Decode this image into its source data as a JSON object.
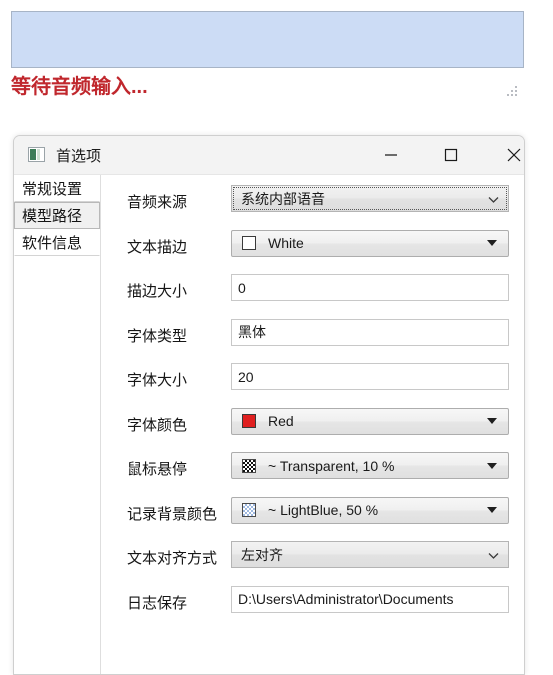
{
  "status_panel": {
    "name": "audio-waveform-panel",
    "background_color": "#ccdcf5",
    "border_color": "#a7b4c6"
  },
  "status": {
    "text": "等待音频输入...",
    "color": "#c0272d"
  },
  "dialog": {
    "title": "首选项",
    "icon": "app-icon",
    "window_controls": {
      "minimize": "minimize-icon",
      "maximize": "maximize-icon",
      "close": "close-icon"
    }
  },
  "sidebar": {
    "items": [
      {
        "label": "常规设置",
        "selected": false
      },
      {
        "label": "模型路径",
        "selected": true
      },
      {
        "label": "软件信息",
        "selected": false
      }
    ]
  },
  "form": {
    "rows": [
      {
        "label": "音频来源",
        "control": "combo-native",
        "value": "系统内部语音",
        "focused": true,
        "name": "audio-source-combo"
      },
      {
        "label": "文本描边",
        "control": "combo-color",
        "value": "White",
        "swatch": "solid",
        "swatch_color": "#ffffff",
        "name": "text-outline-color-combo"
      },
      {
        "label": "描边大小",
        "control": "textbox",
        "value": "0",
        "name": "outline-size-input"
      },
      {
        "label": "字体类型",
        "control": "textbox",
        "value": "黑体",
        "name": "font-family-input"
      },
      {
        "label": "字体大小",
        "control": "textbox",
        "value": "20",
        "name": "font-size-input"
      },
      {
        "label": "字体颜色",
        "control": "combo-color",
        "value": "Red",
        "swatch": "solid",
        "swatch_color": "#e02020",
        "name": "font-color-combo"
      },
      {
        "label": "鼠标悬停",
        "control": "combo-color",
        "value": "~ Transparent, 10 %",
        "swatch": "checker-dark",
        "name": "hover-color-combo"
      },
      {
        "label": "记录背景颜色",
        "control": "combo-color",
        "value": "~ LightBlue, 50 %",
        "swatch": "checker-blue",
        "name": "record-background-color-combo"
      },
      {
        "label": "文本对齐方式",
        "control": "combo-native",
        "value": "左对齐",
        "focused": false,
        "name": "text-align-combo"
      },
      {
        "label": "日志保存",
        "control": "textbox",
        "value": "D:\\Users\\Administrator\\Documents",
        "name": "log-path-input"
      }
    ]
  }
}
